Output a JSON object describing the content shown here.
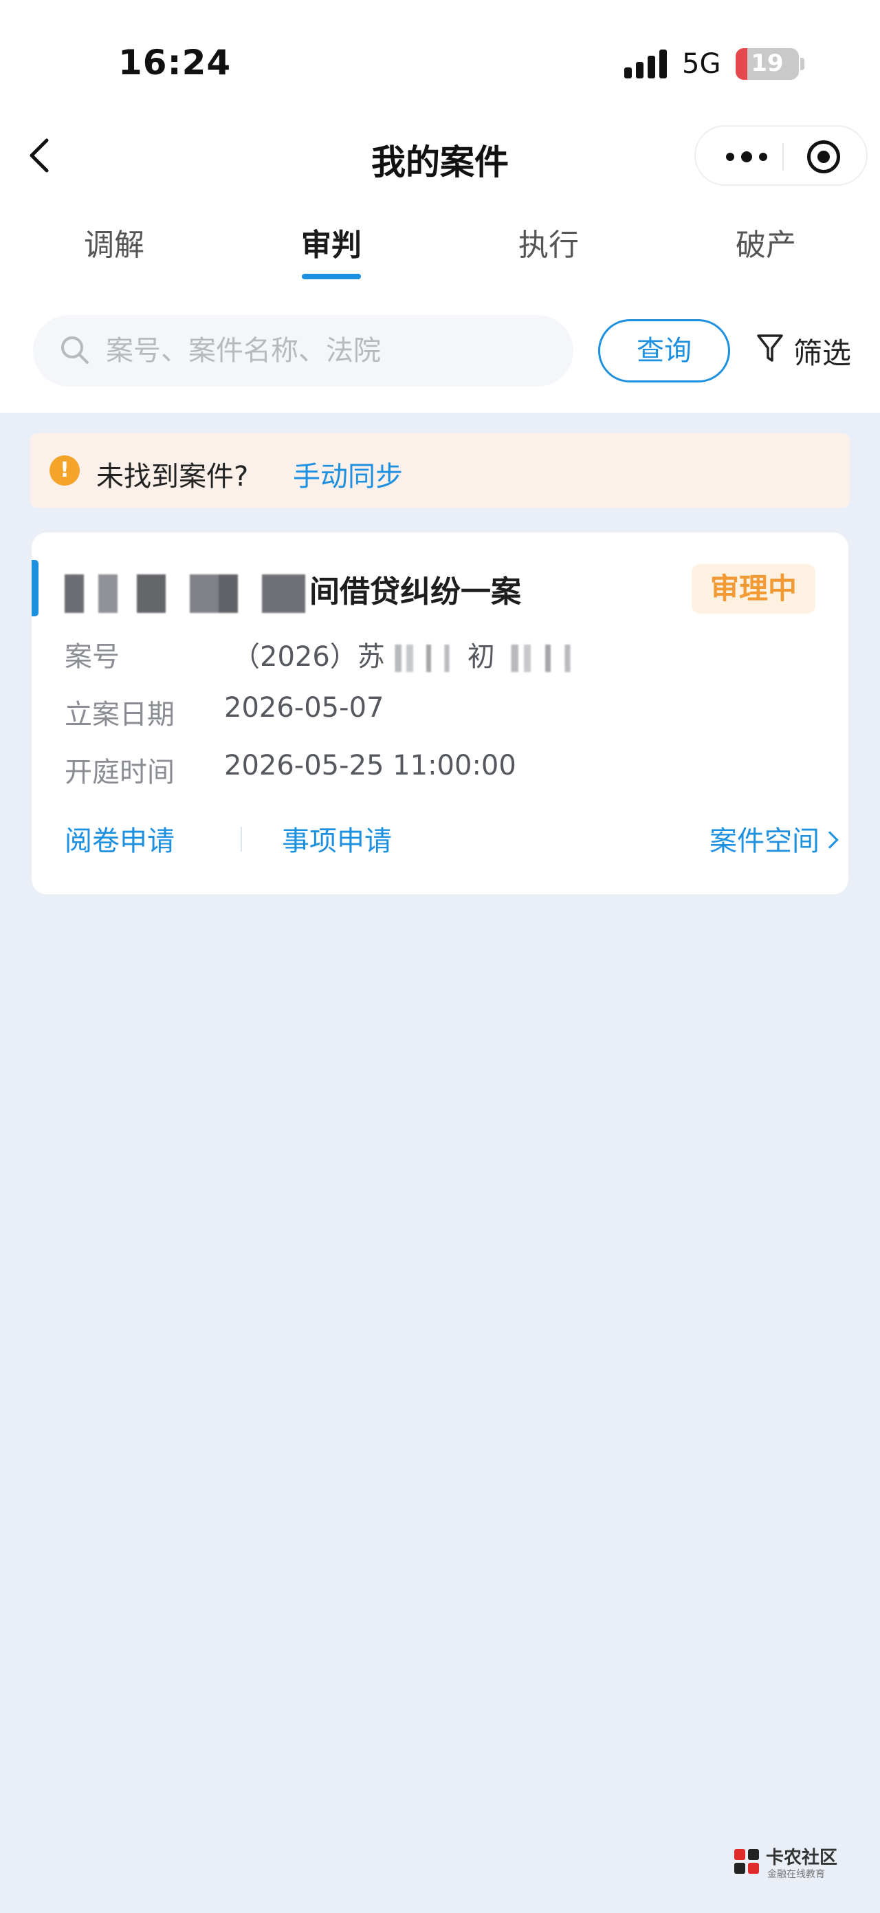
{
  "status_bar": {
    "time": "16:24",
    "network": "5G",
    "battery": "19",
    "battery_level_percent": 19
  },
  "nav": {
    "title": "我的案件",
    "back_icon": "chevron-left-icon",
    "more_icon": "more-dots-icon",
    "close_icon": "target-icon"
  },
  "tabs": [
    {
      "label": "调解",
      "active": false
    },
    {
      "label": "审判",
      "active": true
    },
    {
      "label": "执行",
      "active": false
    },
    {
      "label": "破产",
      "active": false
    }
  ],
  "search": {
    "placeholder": "案号、案件名称、法院",
    "value": "",
    "query_label": "查询",
    "filter_label": "筛选"
  },
  "notice": {
    "text": "未找到案件?",
    "link": "手动同步",
    "icon_text": "!",
    "color": "#f5a42a"
  },
  "case_card": {
    "title_suffix": "间借贷纠纷一案",
    "status": "审理中",
    "fields": [
      {
        "label": "案号",
        "value_prefix": "（2026）苏",
        "value_mid": "初"
      },
      {
        "label": "立案日期",
        "value": "2026-05-07"
      },
      {
        "label": "开庭时间",
        "value": "2026-05-25 11:00:00"
      }
    ],
    "actions": {
      "read_file": "阅卷申请",
      "matter_apply": "事项申请",
      "case_space": "案件空间"
    }
  },
  "watermark": {
    "name": "卡农社区",
    "sub": "金融在线教育"
  },
  "colors": {
    "accent": "#1e90e0",
    "badge_text": "#f29b35",
    "background": "#e9eef7"
  }
}
